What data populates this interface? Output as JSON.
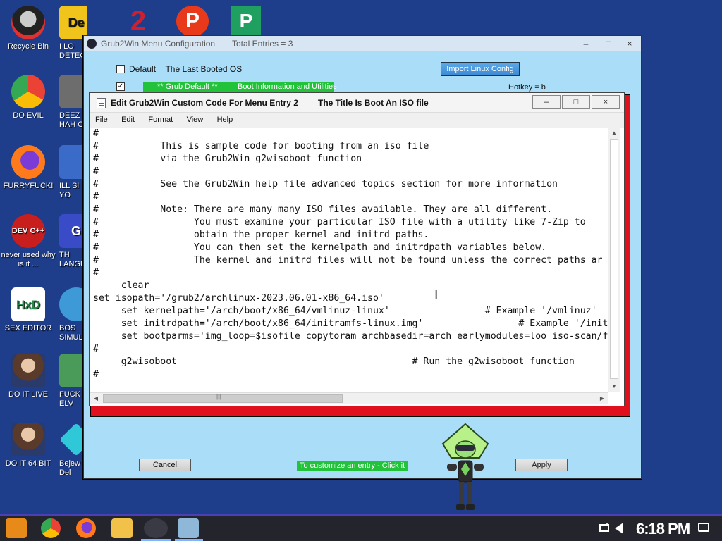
{
  "desktop": {
    "icons": [
      {
        "label": "Recycle Bin",
        "color": "#e03030"
      },
      {
        "label": "DO EVIL",
        "color": "#ffffff"
      },
      {
        "label": "FURRYFUCK!",
        "color": "#ff7a1a"
      },
      {
        "label": "never used why is it ...",
        "color": "#c81e1e"
      },
      {
        "label": "SEX EDITOR",
        "color": "#ffffff"
      },
      {
        "label": "DO IT LIVE",
        "color": "#888888"
      },
      {
        "label": "DO IT 64 BIT",
        "color": "#999999"
      }
    ],
    "icons_col2": [
      {
        "label": "I LO DETEC",
        "color": "#f0c41a",
        "glyph": "De"
      },
      {
        "label": "DEEZ HAH C",
        "color": "#6d6d6d",
        "glyph": ""
      },
      {
        "label": "ILL SI YO",
        "color": "#3a6bc8",
        "glyph": ""
      },
      {
        "label": "TH LANGU",
        "color": "#3a4bc8",
        "glyph": "G"
      },
      {
        "label": "BOS SIMUL",
        "color": "#3d9ad6",
        "glyph": ""
      },
      {
        "label": "FUCK ELV",
        "color": "#4a9a5a",
        "glyph": ""
      },
      {
        "label": "Bejew Del",
        "color": "#2ec8d8",
        "glyph": ""
      }
    ],
    "top_icons": [
      {
        "glyph": "2",
        "color": "#d02030"
      },
      {
        "glyph": "P",
        "color": "#e83a1a"
      },
      {
        "glyph": "P",
        "color": "#20a060"
      }
    ],
    "icon_glyphs": {
      "dev": "DEV C++",
      "hxd": "HxD"
    }
  },
  "back_window": {
    "title": "Grub2Win Menu Configuration",
    "entries": "Total Entries = 3",
    "default_label": "Default = The Last Booted OS",
    "import_button": "Import Linux Config",
    "row_default": "** Grub Default **",
    "row_boot_info": "Boot Information and Utilities",
    "hotkey": "Hotkey = b",
    "cancel_button": "Cancel",
    "customize_label": "To customize an entry - Click it",
    "apply_button": "Apply",
    "checkbox_mark": "✓"
  },
  "editor": {
    "title": "Edit Grub2Win Custom Code For Menu Entry 2",
    "subtitle": "The Title Is Boot An ISO file",
    "controls": {
      "minimize": "–",
      "maximize": "□",
      "close": "×"
    },
    "menu": [
      "File",
      "Edit",
      "Format",
      "View",
      "Help"
    ],
    "lines": [
      "#",
      "#           This is sample code for booting from an iso file",
      "#           via the Grub2Win g2wisoboot function",
      "#",
      "#           See the Grub2Win help file advanced topics section for more information",
      "#",
      "#           Note: There are many many ISO files available. They are all different.",
      "#                 You must examine your particular ISO file with a utility like 7-Zip to",
      "#                 obtain the proper kernel and initrd paths.",
      "#                 You can then set the kernelpath and initrdpath variables below.",
      "#                 The kernel and initrd files will not be found unless the correct paths ar",
      "#",
      "     clear",
      "set isopath='/grub2/archlinux-2023.06.01-x86_64.iso'",
      "     set kernelpath='/arch/boot/x86_64/vmlinuz-linux'                 # Example '/vmlinuz'",
      "     set initrdpath='/arch/boot/x86_64/initramfs-linux.img'                 # Example '/init",
      "     set bootparms='img_loop=$isofile copytoram archbasedir=arch earlymodules=loo iso-scan/f",
      "#",
      "     g2wisoboot                                          # Run the g2wisoboot function",
      "#"
    ],
    "ibeam": "I"
  },
  "taskbar": {
    "clock": "6:18 PM",
    "tray_glyph": "^"
  }
}
